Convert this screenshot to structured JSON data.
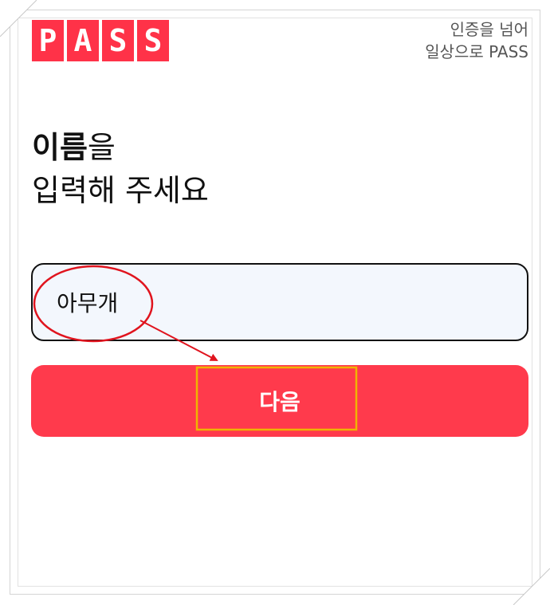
{
  "brand": {
    "logo_letters": [
      "P",
      "A",
      "S",
      "S"
    ],
    "tagline_line1": "인증을 넘어",
    "tagline_line2": "일상으로 PASS",
    "accent_color": "#ff3248"
  },
  "form": {
    "heading_bold": "이름",
    "heading_rest": "을",
    "heading_line2": "입력해 주세요",
    "name_value": "아무개",
    "next_label": "다음"
  },
  "annotations": {
    "circle_color": "#e0141e",
    "box_color": "#f0b400"
  }
}
